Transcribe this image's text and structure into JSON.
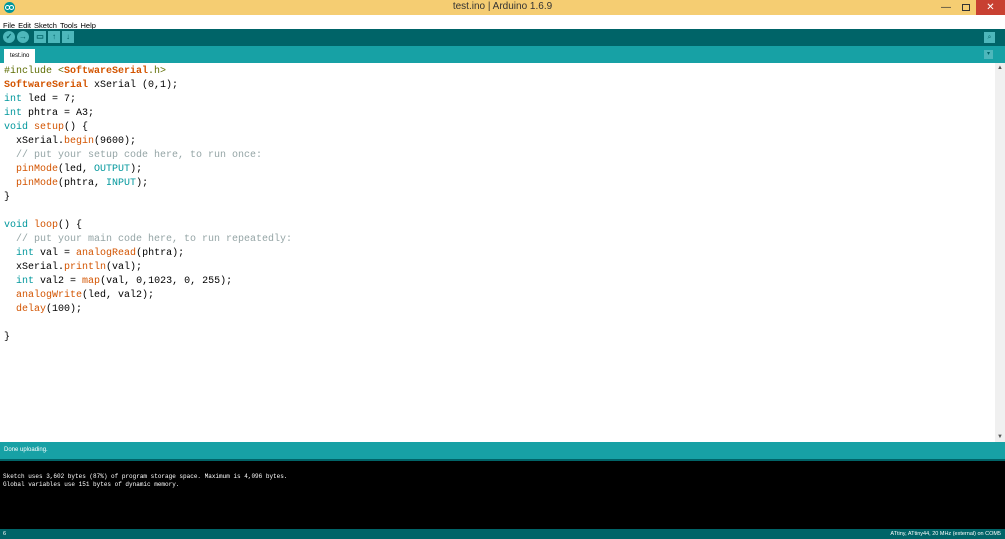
{
  "window": {
    "title": "test.ino | Arduino 1.6.9",
    "minimize": "—",
    "close": "✕"
  },
  "menu": [
    "File",
    "Edit",
    "Sketch",
    "Tools",
    "Help"
  ],
  "toolbar": {
    "verify": "✓",
    "upload": "→",
    "new": "▭",
    "open": "↑",
    "save": "↓",
    "serial": "⌕"
  },
  "tabs": {
    "active": "test.ino",
    "menu": "▾"
  },
  "code": {
    "l1": [
      "#include ",
      "<",
      "SoftwareSerial",
      ".h>"
    ],
    "l2": [
      "SoftwareSerial",
      " xSerial (0,1);"
    ],
    "l3": [
      "int",
      " led = 7;"
    ],
    "l4": [
      "int",
      " phtra = A3;"
    ],
    "l5": [
      "void",
      " ",
      "setup",
      "() {"
    ],
    "l6": [
      "  xSerial.",
      "begin",
      "(9600);"
    ],
    "l7": [
      "  // put your setup code here, to run once:"
    ],
    "l8": [
      "  ",
      "pinMode",
      "(led, ",
      "OUTPUT",
      ");"
    ],
    "l9": [
      "  ",
      "pinMode",
      "(phtra, ",
      "INPUT",
      ");"
    ],
    "l10": [
      "}"
    ],
    "l11": [
      "void",
      " ",
      "loop",
      "() {"
    ],
    "l12": [
      "  // put your main code here, to run repeatedly:"
    ],
    "l13": [
      "  ",
      "int",
      " val = ",
      "analogRead",
      "(phtra);"
    ],
    "l14": [
      "  xSerial.",
      "println",
      "(val);"
    ],
    "l15": [
      "  ",
      "int",
      " val2 = ",
      "map",
      "(val, 0,1023, 0, 255);"
    ],
    "l16": [
      "  ",
      "analogWrite",
      "(led, val2);"
    ],
    "l17": [
      "  ",
      "delay",
      "(100);"
    ],
    "l18": [
      "}"
    ]
  },
  "scroll": {
    "up": "▲",
    "down": "▼"
  },
  "status": {
    "message": "Done uploading."
  },
  "console": {
    "line1": "Sketch uses 3,602 bytes (87%) of program storage space. Maximum is 4,096 bytes.",
    "line2": "Global variables use 151 bytes of dynamic memory."
  },
  "footer": {
    "line_number": "6",
    "board": "ATtiny, ATtiny44, 20 MHz (external) on COM5"
  }
}
